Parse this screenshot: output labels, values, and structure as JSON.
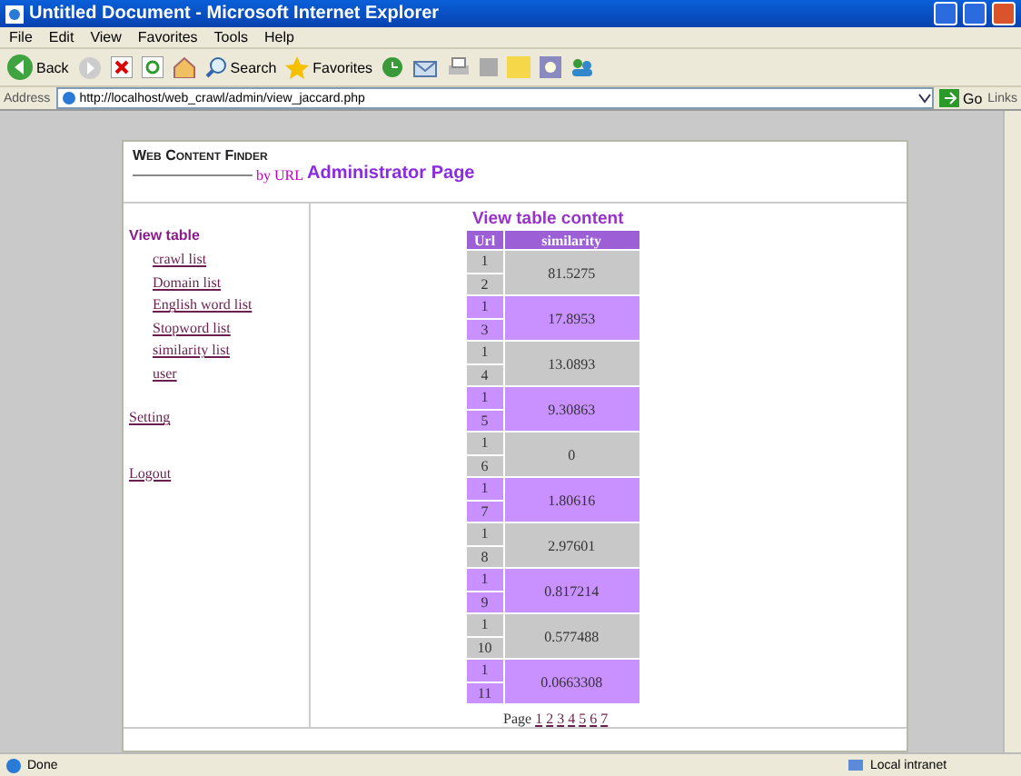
{
  "window": {
    "title": "Untitled Document - Microsoft Internet Explorer"
  },
  "menu": [
    "File",
    "Edit",
    "View",
    "Favorites",
    "Tools",
    "Help"
  ],
  "toolbar": {
    "back": "Back",
    "search": "Search",
    "favorites": "Favorites"
  },
  "address": {
    "label": "Address",
    "url": "http://localhost/web_crawl/admin/view_jaccard.php",
    "go": "Go",
    "links": "Links"
  },
  "site": {
    "name": "Web Content Finder",
    "by": "by URL",
    "page_title": "Administrator Page"
  },
  "sidebar": {
    "heading": "View table",
    "items": [
      "crawl list",
      "Domain list",
      "English word list",
      "Stopword list",
      "similarity list",
      "user"
    ],
    "setting": "Setting",
    "logout": "Logout"
  },
  "table": {
    "title": "View table content",
    "columns": [
      "Url",
      "similarity"
    ],
    "rows": [
      {
        "url_a": "1",
        "url_b": "2",
        "similarity": "81.5275"
      },
      {
        "url_a": "1",
        "url_b": "3",
        "similarity": "17.8953"
      },
      {
        "url_a": "1",
        "url_b": "4",
        "similarity": "13.0893"
      },
      {
        "url_a": "1",
        "url_b": "5",
        "similarity": "9.30863"
      },
      {
        "url_a": "1",
        "url_b": "6",
        "similarity": "0"
      },
      {
        "url_a": "1",
        "url_b": "7",
        "similarity": "1.80616"
      },
      {
        "url_a": "1",
        "url_b": "8",
        "similarity": "2.97601"
      },
      {
        "url_a": "1",
        "url_b": "9",
        "similarity": "0.817214"
      },
      {
        "url_a": "1",
        "url_b": "10",
        "similarity": "0.577488"
      },
      {
        "url_a": "1",
        "url_b": "11",
        "similarity": "0.0663308"
      }
    ]
  },
  "pager": {
    "label": "Page",
    "pages": [
      "1",
      "2",
      "3",
      "4",
      "5",
      "6",
      "7"
    ]
  },
  "status_bar": {
    "text": "Done",
    "zone": "Local intranet"
  }
}
